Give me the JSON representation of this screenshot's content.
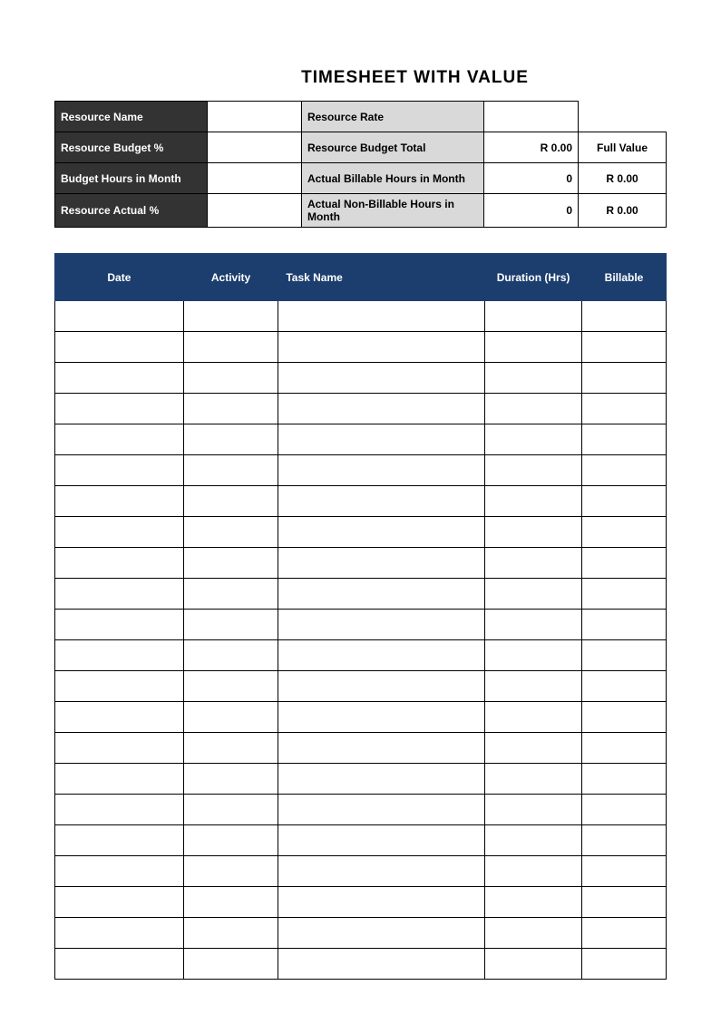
{
  "title": "TIMESHEET WITH VALUE",
  "summary": {
    "rows": [
      {
        "dark": "Resource Name",
        "dark_val": "",
        "grey": "Resource Rate",
        "grey_val": "",
        "full": ""
      },
      {
        "dark": "Resource Budget %",
        "dark_val": "",
        "grey": "Resource Budget Total",
        "grey_val": "R 0.00",
        "full": "Full Value"
      },
      {
        "dark": "Budget Hours in Month",
        "dark_val": "",
        "grey": "Actual Billable Hours in Month",
        "grey_val": "0",
        "full": "R 0.00"
      },
      {
        "dark": "Resource Actual %",
        "dark_val": "",
        "grey": "Actual Non-Billable Hours in Month",
        "grey_val": "0",
        "full": "R 0.00"
      }
    ]
  },
  "entries": {
    "headers": {
      "date": "Date",
      "activity": "Activity",
      "task": "Task Name",
      "duration": "Duration (Hrs)",
      "billable": "Billable"
    },
    "rows": [
      {
        "date": "",
        "activity": "",
        "task": "",
        "duration": "",
        "billable": ""
      },
      {
        "date": "",
        "activity": "",
        "task": "",
        "duration": "",
        "billable": ""
      },
      {
        "date": "",
        "activity": "",
        "task": "",
        "duration": "",
        "billable": ""
      },
      {
        "date": "",
        "activity": "",
        "task": "",
        "duration": "",
        "billable": ""
      },
      {
        "date": "",
        "activity": "",
        "task": "",
        "duration": "",
        "billable": ""
      },
      {
        "date": "",
        "activity": "",
        "task": "",
        "duration": "",
        "billable": ""
      },
      {
        "date": "",
        "activity": "",
        "task": "",
        "duration": "",
        "billable": ""
      },
      {
        "date": "",
        "activity": "",
        "task": "",
        "duration": "",
        "billable": ""
      },
      {
        "date": "",
        "activity": "",
        "task": "",
        "duration": "",
        "billable": ""
      },
      {
        "date": "",
        "activity": "",
        "task": "",
        "duration": "",
        "billable": ""
      },
      {
        "date": "",
        "activity": "",
        "task": "",
        "duration": "",
        "billable": ""
      },
      {
        "date": "",
        "activity": "",
        "task": "",
        "duration": "",
        "billable": ""
      },
      {
        "date": "",
        "activity": "",
        "task": "",
        "duration": "",
        "billable": ""
      },
      {
        "date": "",
        "activity": "",
        "task": "",
        "duration": "",
        "billable": ""
      },
      {
        "date": "",
        "activity": "",
        "task": "",
        "duration": "",
        "billable": ""
      },
      {
        "date": "",
        "activity": "",
        "task": "",
        "duration": "",
        "billable": ""
      },
      {
        "date": "",
        "activity": "",
        "task": "",
        "duration": "",
        "billable": ""
      },
      {
        "date": "",
        "activity": "",
        "task": "",
        "duration": "",
        "billable": ""
      },
      {
        "date": "",
        "activity": "",
        "task": "",
        "duration": "",
        "billable": ""
      },
      {
        "date": "",
        "activity": "",
        "task": "",
        "duration": "",
        "billable": ""
      },
      {
        "date": "",
        "activity": "",
        "task": "",
        "duration": "",
        "billable": ""
      },
      {
        "date": "",
        "activity": "",
        "task": "",
        "duration": "",
        "billable": ""
      }
    ]
  }
}
